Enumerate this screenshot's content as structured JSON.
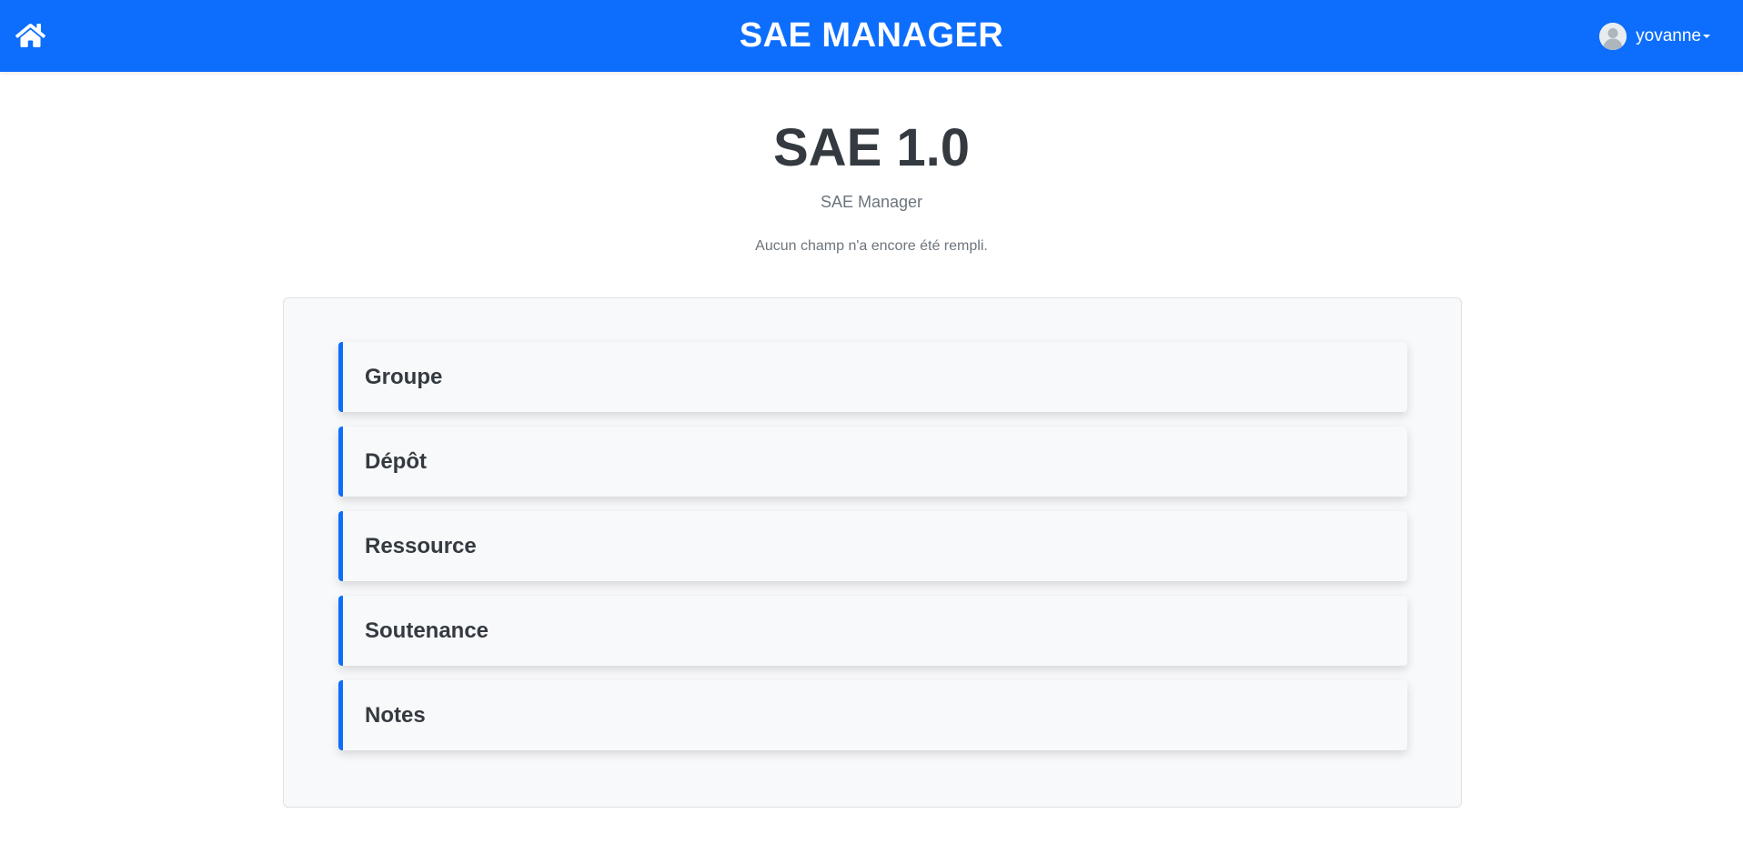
{
  "navbar": {
    "brand": "SAE MANAGER",
    "user_name": "yovanne",
    "icons": {
      "home": "home-icon",
      "avatar": "user-avatar-icon",
      "dropdown": "caret-down-icon"
    },
    "colors": {
      "primary": "#0d6efd",
      "text_on_primary": "#ffffff"
    }
  },
  "header": {
    "title": "SAE 1.0",
    "subtitle": "SAE Manager",
    "notice": "Aucun champ n'a encore été rempli."
  },
  "sections": [
    {
      "label": "Groupe"
    },
    {
      "label": "Dépôt"
    },
    {
      "label": "Ressource"
    },
    {
      "label": "Soutenance"
    },
    {
      "label": "Notes"
    }
  ],
  "colors": {
    "accent": "#0d6efd",
    "heading_text": "#343a40",
    "muted_text": "#6c757d",
    "panel_background": "#f8f9fa",
    "panel_border": "#dee2e6"
  }
}
